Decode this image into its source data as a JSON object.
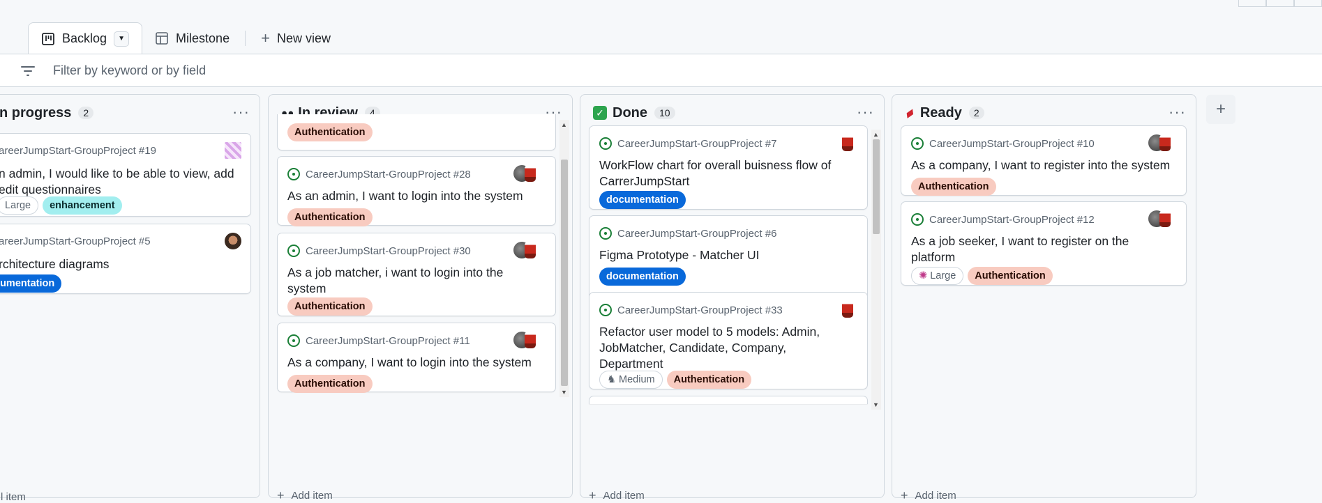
{
  "tabs": {
    "backlog": "Backlog",
    "milestone": "Milestone",
    "new_view": "New view"
  },
  "filter": {
    "placeholder": "Filter by keyword or by field"
  },
  "columns": [
    {
      "title": "n progress",
      "count": "2",
      "add_item": "l item",
      "cards": [
        {
          "ref": "areerJumpStart-GroupProject #19",
          "title": "n admin, I would like to be able to view, add edit questionnaires",
          "labels": [
            "Large",
            "enhancement"
          ]
        },
        {
          "ref": "areerJumpStart-GroupProject #5",
          "title": "rchitecture diagrams",
          "labels": [
            "cumentation"
          ]
        }
      ]
    },
    {
      "title": "In review",
      "count": "4",
      "add_item": "Add item",
      "cards": [
        {
          "ref": "",
          "title": "",
          "labels": [
            "Authentication"
          ]
        },
        {
          "ref": "CareerJumpStart-GroupProject #28",
          "title": "As an admin, I want to login into the system",
          "labels": [
            "Authentication"
          ]
        },
        {
          "ref": "CareerJumpStart-GroupProject #30",
          "title": "As a job matcher, i want to login into the system",
          "labels": [
            "Authentication"
          ]
        },
        {
          "ref": "CareerJumpStart-GroupProject #11",
          "title": "As a company, I want to login into the system",
          "labels": [
            "Authentication"
          ]
        }
      ]
    },
    {
      "title": "Done",
      "count": "10",
      "add_item": "Add item",
      "cards": [
        {
          "ref": "CareerJumpStart-GroupProject #7",
          "title": "WorkFlow chart for overall buisness flow of CarrerJumpStart",
          "labels": [
            "documentation"
          ]
        },
        {
          "ref": "CareerJumpStart-GroupProject #6",
          "title": "Figma Prototype - Matcher UI",
          "labels": [
            "documentation"
          ]
        },
        {
          "ref": "CareerJumpStart-GroupProject #33",
          "title": "Refactor user model to 5 models: Admin, JobMatcher, Candidate, Company, Department",
          "labels": [
            "Medium",
            "Authentication"
          ]
        }
      ]
    },
    {
      "title": "Ready",
      "count": "2",
      "add_item": "Add item",
      "cards": [
        {
          "ref": "CareerJumpStart-GroupProject #10",
          "title": "As a company, I want to register into the system",
          "labels": [
            "Authentication"
          ]
        },
        {
          "ref": "CareerJumpStart-GroupProject #12",
          "title": "As a job seeker, I want to register on the platform",
          "labels": [
            "Large",
            "Authentication"
          ]
        }
      ]
    }
  ],
  "icons": {
    "in_review_emoji": "eyes-icon",
    "done_emoji": "check-mark-icon",
    "ready_emoji": "ticket-icon",
    "more": "kebab-icon",
    "add": "plus-icon"
  },
  "colors": {
    "accent_green": "#1a7f37",
    "auth_label": "#f8cbc0",
    "doc_label": "#0969da",
    "enh_label": "#a2eeef"
  }
}
